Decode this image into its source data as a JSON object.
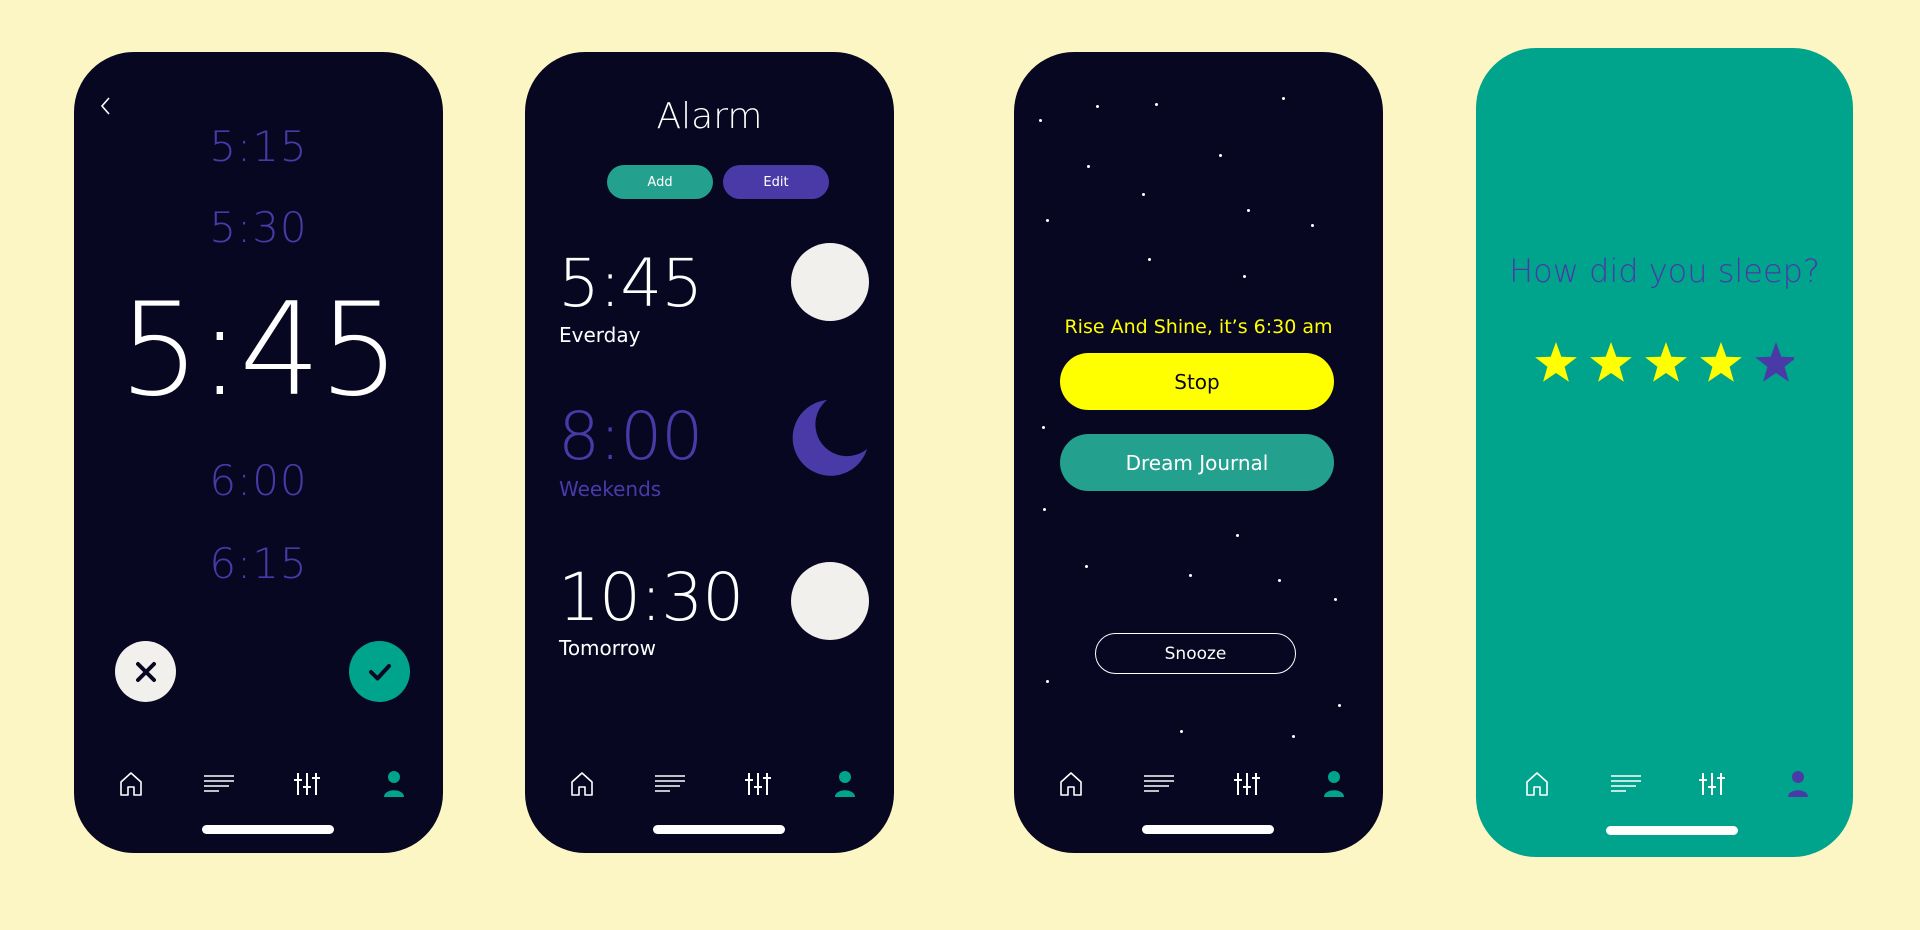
{
  "colors": {
    "background": "#fcf6c4",
    "phone_dark": "#070722",
    "teal": "#00a38c",
    "teal_button": "#24a08e",
    "purple": "#4a3aa8",
    "yellow": "#ffff00",
    "white": "#ffffff",
    "toggle_off": "#f2f0ec"
  },
  "screen1": {
    "times": [
      "5:15",
      "5:30",
      "5:45",
      "6:00",
      "6:15"
    ],
    "back_icon": "chevron-left-icon",
    "cancel_icon": "close-icon",
    "confirm_icon": "check-icon"
  },
  "screen2": {
    "title": "Alarm",
    "add_label": "Add",
    "edit_label": "Edit",
    "alarms": [
      {
        "time": "5:45",
        "label": "Everday",
        "state": "off"
      },
      {
        "time": "8:00",
        "label": "Weekends",
        "state": "moon"
      },
      {
        "time": "10:30",
        "label": "Tomorrow",
        "state": "off"
      }
    ]
  },
  "screen3": {
    "message": "Rise And Shine, it’s 6:30 am",
    "stop_label": "Stop",
    "journal_label": "Dream Journal",
    "snooze_label": "Snooze"
  },
  "screen4": {
    "question": "How did you sleep?",
    "rating": 4,
    "max_rating": 5
  },
  "tabbar": {
    "icons": [
      "home-icon",
      "list-icon",
      "sliders-icon",
      "profile-icon"
    ],
    "active": 3
  }
}
